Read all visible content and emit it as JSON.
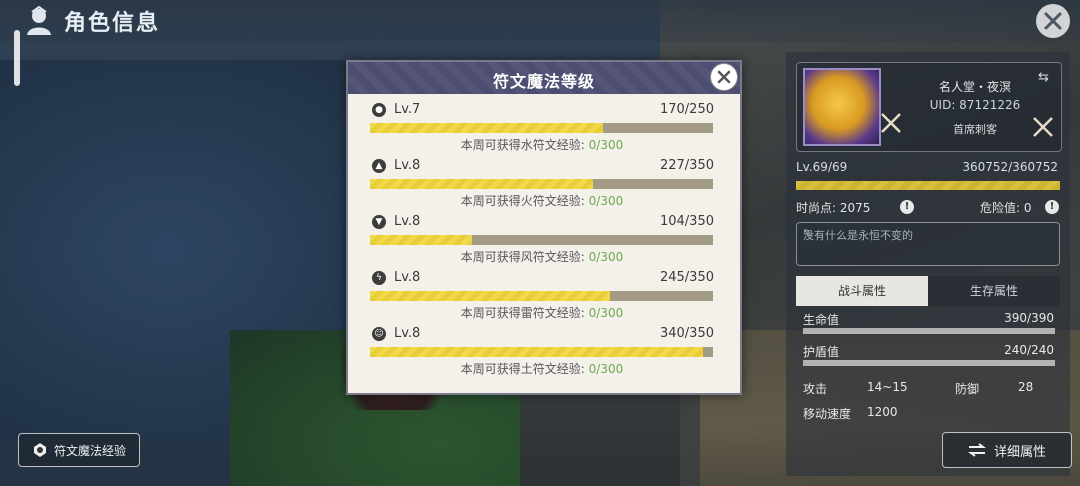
{
  "header": {
    "title": "角色信息"
  },
  "profile": {
    "name": "名人堂・夜溟",
    "uid": "UID: 87121226",
    "title": "首席刺客",
    "level": "Lv.69/69",
    "hp": "360752/360752",
    "level_progress": 1.0,
    "fashion": "时尚点: 2075",
    "danger": "危险值: 0",
    "motto_placeholder": "没有什么是永恒不变的"
  },
  "tabs": [
    {
      "label": "战斗属性"
    },
    {
      "label": "生存属性"
    }
  ],
  "stats": {
    "life_label": "生命值",
    "life_value": "390/390",
    "shield_label": "护盾值",
    "shield_value": "240/240",
    "attack_label": "攻击",
    "attack_value": "14~15",
    "defense_label": "防御",
    "defense_value": "28",
    "speed_label": "移动速度",
    "speed_value": "1200"
  },
  "buttons": {
    "detail": "详细属性",
    "rune_xp": "符文魔法经验"
  },
  "modal": {
    "title": "符文魔法等级",
    "runes": [
      {
        "icon": "water-drop-icon",
        "level": "Lv.7",
        "xp": "170/250",
        "progress": 0.68,
        "week_text": "本周可获得水符文经验:",
        "week_value": "0/300"
      },
      {
        "icon": "fire-icon",
        "level": "Lv.8",
        "xp": "227/350",
        "progress": 0.649,
        "week_text": "本周可获得火符文经验:",
        "week_value": "0/300"
      },
      {
        "icon": "wind-icon",
        "level": "Lv.8",
        "xp": "104/350",
        "progress": 0.297,
        "week_text": "本周可获得风符文经验:",
        "week_value": "0/300"
      },
      {
        "icon": "thunder-icon",
        "level": "Lv.8",
        "xp": "245/350",
        "progress": 0.7,
        "week_text": "本周可获得雷符文经验:",
        "week_value": "0/300"
      },
      {
        "icon": "earth-icon",
        "level": "Lv.8",
        "xp": "340/350",
        "progress": 0.971,
        "week_text": "本周可获得土符文经验:",
        "week_value": "0/300"
      }
    ]
  }
}
